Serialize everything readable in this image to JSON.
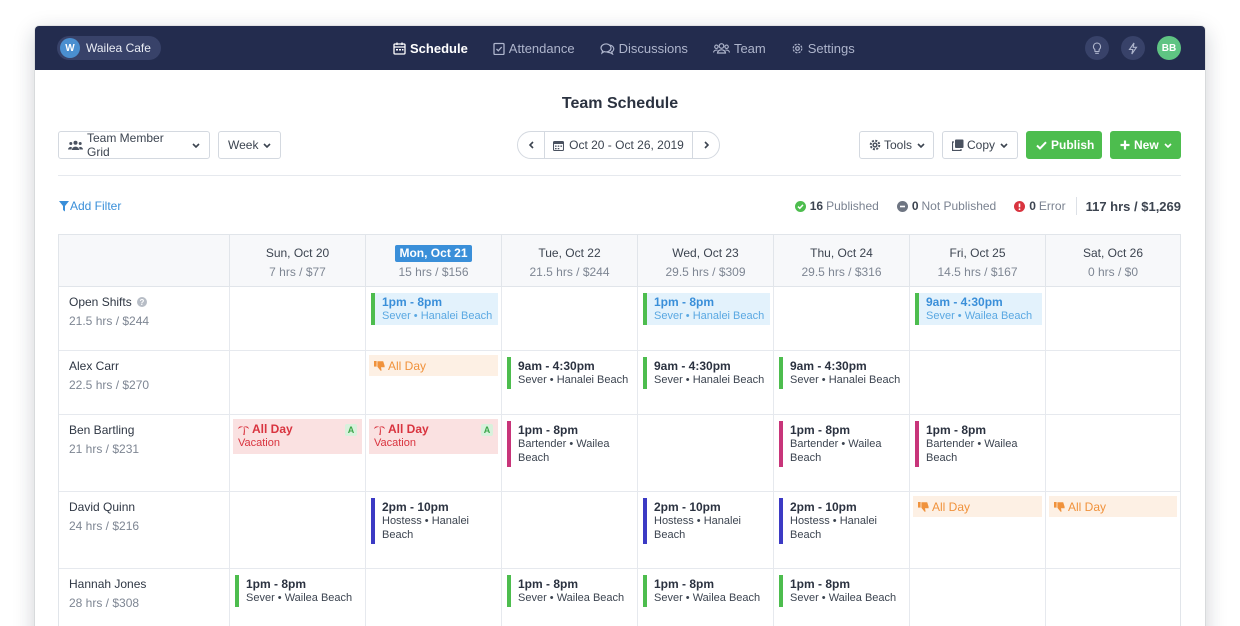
{
  "brand": {
    "initial": "W",
    "name": "Wailea Cafe"
  },
  "nav": [
    {
      "label": "Schedule",
      "icon": "calendar-icon",
      "active": true
    },
    {
      "label": "Attendance",
      "icon": "clipboard-check-icon",
      "active": false
    },
    {
      "label": "Discussions",
      "icon": "chat-bubbles-icon",
      "active": false
    },
    {
      "label": "Team",
      "icon": "team-icon",
      "active": false
    },
    {
      "label": "Settings",
      "icon": "gear-icon",
      "active": false
    }
  ],
  "user": {
    "initials": "BB"
  },
  "page_title": "Team Schedule",
  "toolbar": {
    "view_label": "Team Member Grid",
    "range_label": "Week",
    "date_range": "Oct 20 - Oct 26, 2019",
    "tools_label": "Tools",
    "copy_label": "Copy",
    "publish_label": "Publish",
    "new_label": "New"
  },
  "filter": {
    "add_label": "Add Filter"
  },
  "stats": {
    "published_count": "16",
    "published_label": "Published",
    "not_published_count": "0",
    "not_published_label": "Not Published",
    "error_count": "0",
    "error_label": "Error",
    "total": "117 hrs / $1,269"
  },
  "colors": {
    "nav_bg": "#232c4e",
    "accent_blue": "#3a8fd9",
    "publish_green": "#4dbd4e",
    "server_bar": "#4dbd4e",
    "bartender_bar": "#c8357a",
    "hostess_bar": "#3c3ac4",
    "vacation_bg": "#fae1e1",
    "allday_bg": "#fdf0e4"
  },
  "days": [
    {
      "label": "Sun, Oct 20",
      "summary": "7 hrs / $77"
    },
    {
      "label": "Mon, Oct 21",
      "summary": "15 hrs / $156",
      "today": true
    },
    {
      "label": "Tue, Oct 22",
      "summary": "21.5 hrs / $244"
    },
    {
      "label": "Wed, Oct 23",
      "summary": "29.5 hrs / $309"
    },
    {
      "label": "Thu, Oct 24",
      "summary": "29.5 hrs / $316"
    },
    {
      "label": "Fri, Oct 25",
      "summary": "14.5 hrs / $167"
    },
    {
      "label": "Sat, Oct 26",
      "summary": "0 hrs / $0"
    }
  ],
  "rows": [
    {
      "name": "Open Shifts",
      "summary": "21.5 hrs / $244",
      "info": true,
      "cells": [
        null,
        {
          "kind": "open",
          "time": "1pm - 8pm",
          "sub": "Sever • Hanalei Beach"
        },
        null,
        {
          "kind": "open",
          "time": "1pm - 8pm",
          "sub": "Sever • Hanalei Beach"
        },
        null,
        {
          "kind": "open",
          "time": "9am - 4:30pm",
          "sub": "Sever • Wailea Beach"
        },
        null
      ]
    },
    {
      "name": "Alex Carr",
      "summary": "22.5 hrs / $270",
      "cells": [
        null,
        {
          "kind": "allday",
          "label": "All Day"
        },
        {
          "kind": "shift",
          "time": "9am - 4:30pm",
          "sub": "Sever • Hanalei Beach",
          "color": "#4dbd4e"
        },
        {
          "kind": "shift",
          "time": "9am - 4:30pm",
          "sub": "Sever • Hanalei Beach",
          "color": "#4dbd4e"
        },
        {
          "kind": "shift",
          "time": "9am - 4:30pm",
          "sub": "Sever • Hanalei Beach",
          "color": "#4dbd4e"
        },
        null,
        null
      ]
    },
    {
      "name": "Ben Bartling",
      "summary": "21 hrs / $231",
      "cells": [
        {
          "kind": "vacation",
          "label": "All Day",
          "sub": "Vacation",
          "badge": "A"
        },
        {
          "kind": "vacation",
          "label": "All Day",
          "sub": "Vacation",
          "badge": "A"
        },
        {
          "kind": "shift",
          "time": "1pm - 8pm",
          "sub": "Bartender • Wailea Beach",
          "color": "#c8357a"
        },
        null,
        {
          "kind": "shift",
          "time": "1pm - 8pm",
          "sub": "Bartender • Wailea Beach",
          "color": "#c8357a"
        },
        {
          "kind": "shift",
          "time": "1pm - 8pm",
          "sub": "Bartender • Wailea Beach",
          "color": "#c8357a"
        },
        null
      ]
    },
    {
      "name": "David Quinn",
      "summary": "24 hrs / $216",
      "cells": [
        null,
        {
          "kind": "shift",
          "time": "2pm - 10pm",
          "sub": "Hostess • Hanalei Beach",
          "color": "#3c3ac4"
        },
        null,
        {
          "kind": "shift",
          "time": "2pm - 10pm",
          "sub": "Hostess • Hanalei Beach",
          "color": "#3c3ac4"
        },
        {
          "kind": "shift",
          "time": "2pm - 10pm",
          "sub": "Hostess • Hanalei Beach",
          "color": "#3c3ac4"
        },
        {
          "kind": "allday",
          "label": "All Day"
        },
        {
          "kind": "allday",
          "label": "All Day"
        }
      ]
    },
    {
      "name": "Hannah Jones",
      "summary": "28 hrs / $308",
      "cells": [
        {
          "kind": "shift",
          "time": "1pm - 8pm",
          "sub": "Sever • Wailea Beach",
          "color": "#4dbd4e"
        },
        null,
        {
          "kind": "shift",
          "time": "1pm - 8pm",
          "sub": "Sever • Wailea Beach",
          "color": "#4dbd4e"
        },
        {
          "kind": "shift",
          "time": "1pm - 8pm",
          "sub": "Sever • Wailea Beach",
          "color": "#4dbd4e"
        },
        {
          "kind": "shift",
          "time": "1pm - 8pm",
          "sub": "Sever • Wailea Beach",
          "color": "#4dbd4e"
        },
        null,
        null
      ]
    }
  ]
}
